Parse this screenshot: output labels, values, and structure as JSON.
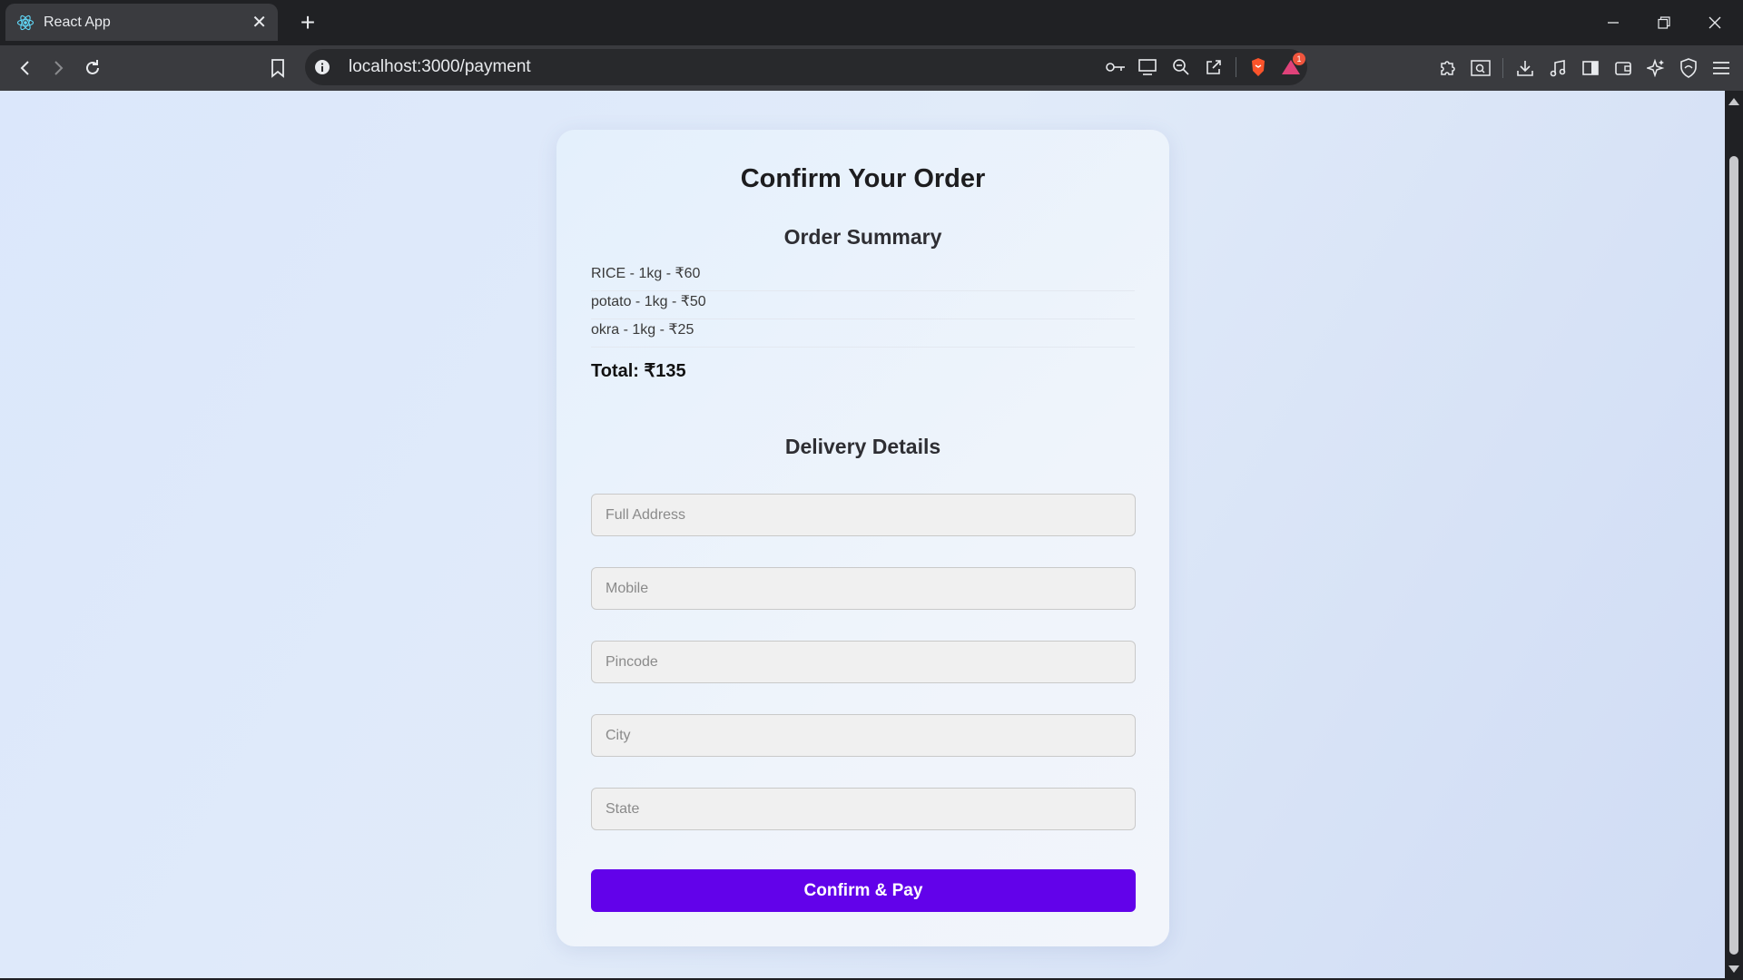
{
  "browser": {
    "tab_title": "React App",
    "url": "localhost:3000/payment",
    "extension_badge_count": "1"
  },
  "page": {
    "heading": "Confirm Your Order",
    "order_summary": {
      "heading": "Order Summary",
      "items": [
        "RICE - 1kg - ₹60",
        "potato - 1kg - ₹50",
        "okra - 1kg - ₹25"
      ],
      "total": "Total: ₹135"
    },
    "delivery": {
      "heading": "Delivery Details",
      "fields": {
        "address": {
          "placeholder": "Full Address",
          "value": ""
        },
        "mobile": {
          "placeholder": "Mobile",
          "value": ""
        },
        "pincode": {
          "placeholder": "Pincode",
          "value": ""
        },
        "city": {
          "placeholder": "City",
          "value": ""
        },
        "state": {
          "placeholder": "State",
          "value": ""
        }
      }
    },
    "submit_label": "Confirm & Pay"
  },
  "colors": {
    "accent": "#6202ea",
    "page_background": "#dbe7fb",
    "card_background": "#eef4fb"
  }
}
